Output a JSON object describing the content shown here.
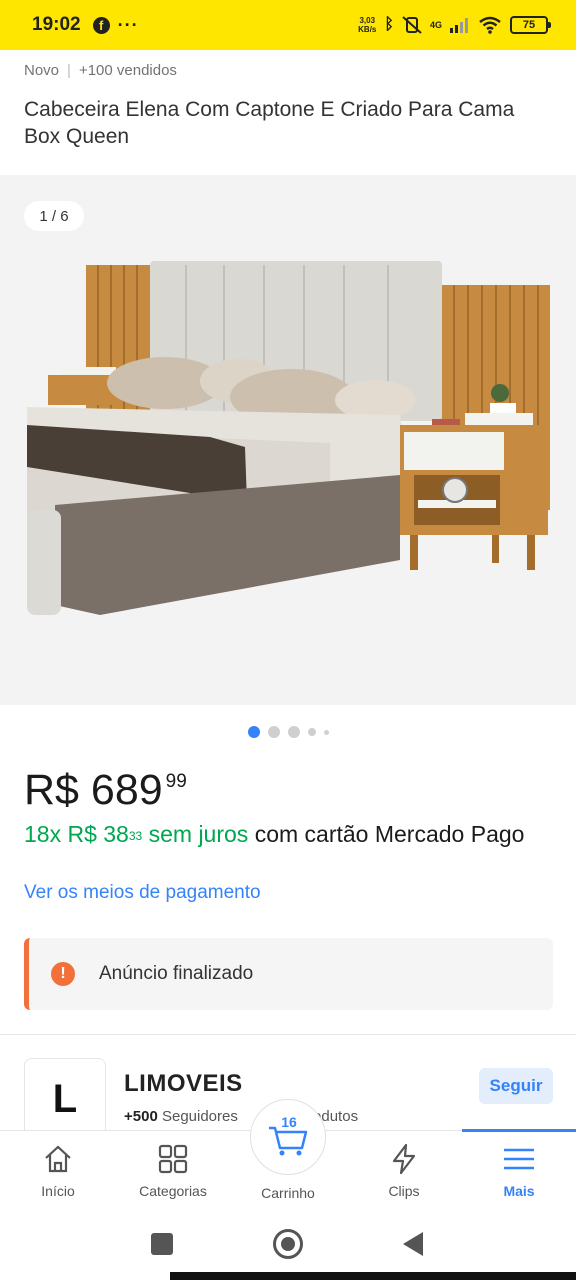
{
  "status_bar": {
    "time": "19:02",
    "facebook_icon": "f",
    "overflow": "···",
    "net_speed_value": "3,03",
    "net_speed_unit": "KB/s",
    "network": "4G",
    "battery": "75"
  },
  "product": {
    "condition": "Novo",
    "sold": "+100 vendidos",
    "title": "Cabeceira Elena Com Captone E Criado Para Cama Box Queen"
  },
  "gallery": {
    "counter": "1 / 6",
    "image_count": 6,
    "active_index": 0
  },
  "price": {
    "currency_amount": "R$ 689",
    "cents": "99",
    "installments_prefix": "18x R$ 38",
    "installments_cents": "33",
    "installments_interest": "sem juros",
    "installments_suffix": "com cartão Mercado Pago",
    "payment_link": "Ver os meios de pagamento"
  },
  "notice": {
    "icon": "!",
    "text": "Anúncio finalizado"
  },
  "seller": {
    "logo_letter": "L",
    "name": "LIMOVEIS",
    "followers_count": "+500",
    "followers_label": "Seguidores",
    "products_label": "Produtos",
    "follow_button": "Seguir"
  },
  "bottom_nav": {
    "items": [
      {
        "label": "Início",
        "icon": "home-icon"
      },
      {
        "label": "Categorias",
        "icon": "grid-icon"
      },
      {
        "label": "Carrinho",
        "icon": "cart-icon"
      },
      {
        "label": "Clips",
        "icon": "lightning-icon"
      },
      {
        "label": "Mais",
        "icon": "menu-icon"
      }
    ],
    "cart_count": "16",
    "active": "Mais"
  },
  "colors": {
    "brand_yellow": "#ffe600",
    "link_blue": "#3483fa",
    "price_green": "#00a650",
    "notice_orange": "#f2703a"
  }
}
